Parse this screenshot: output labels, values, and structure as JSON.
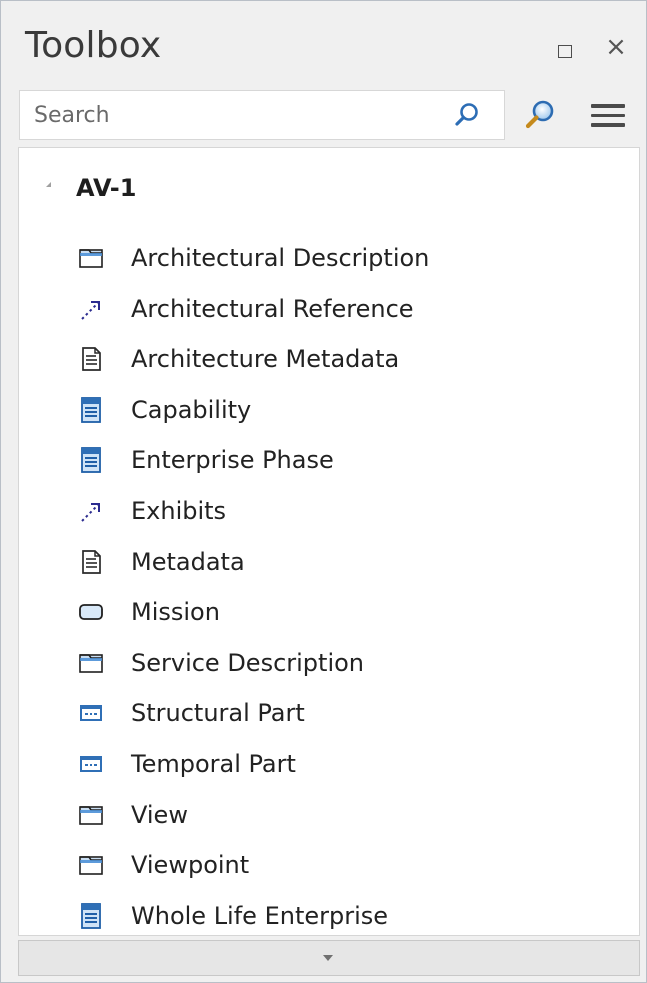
{
  "window": {
    "title": "Toolbox",
    "close_glyph": "×"
  },
  "search": {
    "placeholder": "Search"
  },
  "group": {
    "title": "AV-1",
    "expanded": true
  },
  "items": [
    {
      "label": "Architectural Description",
      "icon": "folder-icon"
    },
    {
      "label": "Architectural Reference",
      "icon": "dependency-arrow-icon"
    },
    {
      "label": "Architecture Metadata",
      "icon": "document-icon"
    },
    {
      "label": "Capability",
      "icon": "class-element-icon"
    },
    {
      "label": "Enterprise Phase",
      "icon": "class-element-icon"
    },
    {
      "label": "Exhibits",
      "icon": "dependency-arrow-icon"
    },
    {
      "label": "Metadata",
      "icon": "document-icon"
    },
    {
      "label": "Mission",
      "icon": "rounded-rect-icon"
    },
    {
      "label": "Service Description",
      "icon": "folder-icon"
    },
    {
      "label": "Structural Part",
      "icon": "part-icon"
    },
    {
      "label": "Temporal Part",
      "icon": "part-icon"
    },
    {
      "label": "View",
      "icon": "folder-icon"
    },
    {
      "label": "Viewpoint",
      "icon": "folder-icon"
    },
    {
      "label": "Whole Life Enterprise",
      "icon": "class-element-icon"
    }
  ],
  "colors": {
    "panel_bg": "#f0f0f0",
    "icon_blue": "#2f6fb6",
    "icon_light_blue": "#cfe3f7"
  }
}
